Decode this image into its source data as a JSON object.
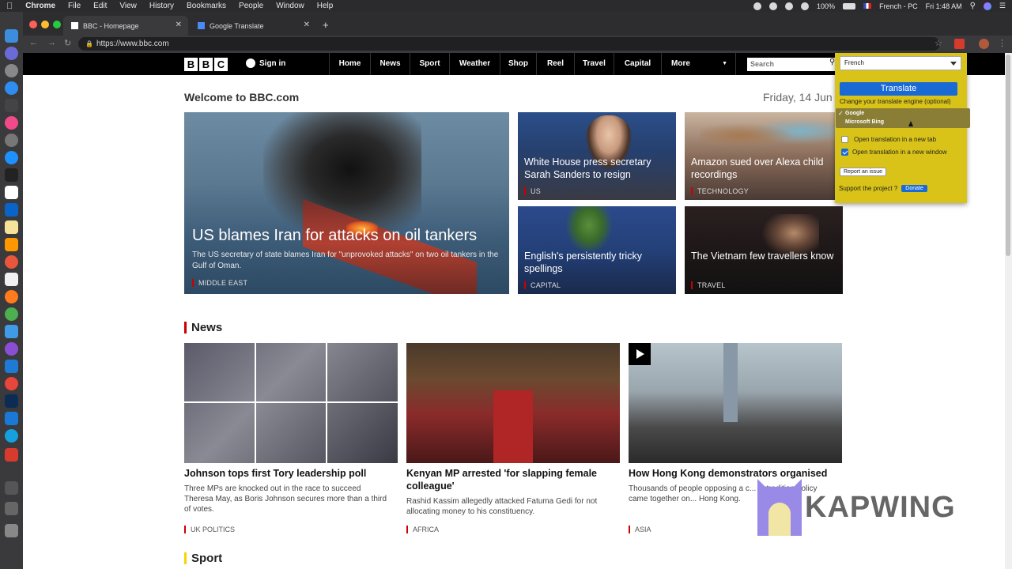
{
  "menubar": {
    "apple": "",
    "items": [
      "Chrome",
      "File",
      "Edit",
      "View",
      "History",
      "Bookmarks",
      "People",
      "Window",
      "Help"
    ],
    "battery": "100%",
    "input_source": "French - PC",
    "clock": "Fri 1:48 AM"
  },
  "browser": {
    "tabs": [
      {
        "title": "BBC - Homepage"
      },
      {
        "title": "Google Translate"
      }
    ],
    "new_tab": "+",
    "url": "https://www.bbc.com"
  },
  "bbc": {
    "logo": [
      "B",
      "B",
      "C"
    ],
    "sign_in": "Sign in",
    "nav": [
      "Home",
      "News",
      "Sport",
      "Weather",
      "Shop",
      "Reel",
      "Travel",
      "Capital",
      "More"
    ],
    "search_placeholder": "Search",
    "welcome": "Welcome to BBC.com",
    "date": "Friday, 14 Jun",
    "hero": {
      "title": "US blames Iran for attacks on oil tankers",
      "summary": "The US secretary of state blames Iran for \"unprovoked attacks\" on two oil tankers in the Gulf of Oman.",
      "tag": "MIDDLE EAST"
    },
    "tiles": [
      {
        "title": "White House press secretary Sarah Sanders to resign",
        "tag": "US"
      },
      {
        "title": "Amazon sued over Alexa child recordings",
        "tag": "TECHNOLOGY"
      },
      {
        "title": "English's persistently tricky spellings",
        "tag": "CAPITAL"
      },
      {
        "title": "The Vietnam few travellers know",
        "tag": "TRAVEL"
      }
    ],
    "news_section": "News",
    "news": [
      {
        "headline": "Johnson tops first Tory leadership poll",
        "body": "Three MPs are knocked out in the race to succeed Theresa May, as Boris Johnson secures more than a third of votes.",
        "tag": "UK POLITICS"
      },
      {
        "headline": "Kenyan MP arrested 'for slapping female colleague'",
        "body": "Rashid Kassim allegedly attacked Fatuma Gedi for not allocating money to his constituency.",
        "tag": "AFRICA"
      },
      {
        "headline": "How Hong Kong demonstrators organised",
        "body": "Thousands of people opposing a c... extradition policy came together on... Hong Kong.",
        "tag": "ASIA"
      }
    ],
    "sport_section": "Sport"
  },
  "translate_popup": {
    "language": "French",
    "translate_button": "Translate",
    "engine_label": "Change your translate engine (optional)",
    "engines": [
      "Google",
      "Microsoft Bing"
    ],
    "selected_engine": "Google",
    "check_mark": "✓",
    "option_new_tab": "Open translation in a new tab",
    "option_new_window": "Open translation in a new window",
    "new_tab_checked": false,
    "new_window_checked": true,
    "report_button": "Report an issue",
    "support_text": "Support the project ?",
    "donate_button": "Donate"
  },
  "watermark": "KAPWING",
  "colors": {
    "bbc_red": "#cc0000",
    "popup_yellow": "#d9c318",
    "translate_blue": "#1a6ad6"
  }
}
